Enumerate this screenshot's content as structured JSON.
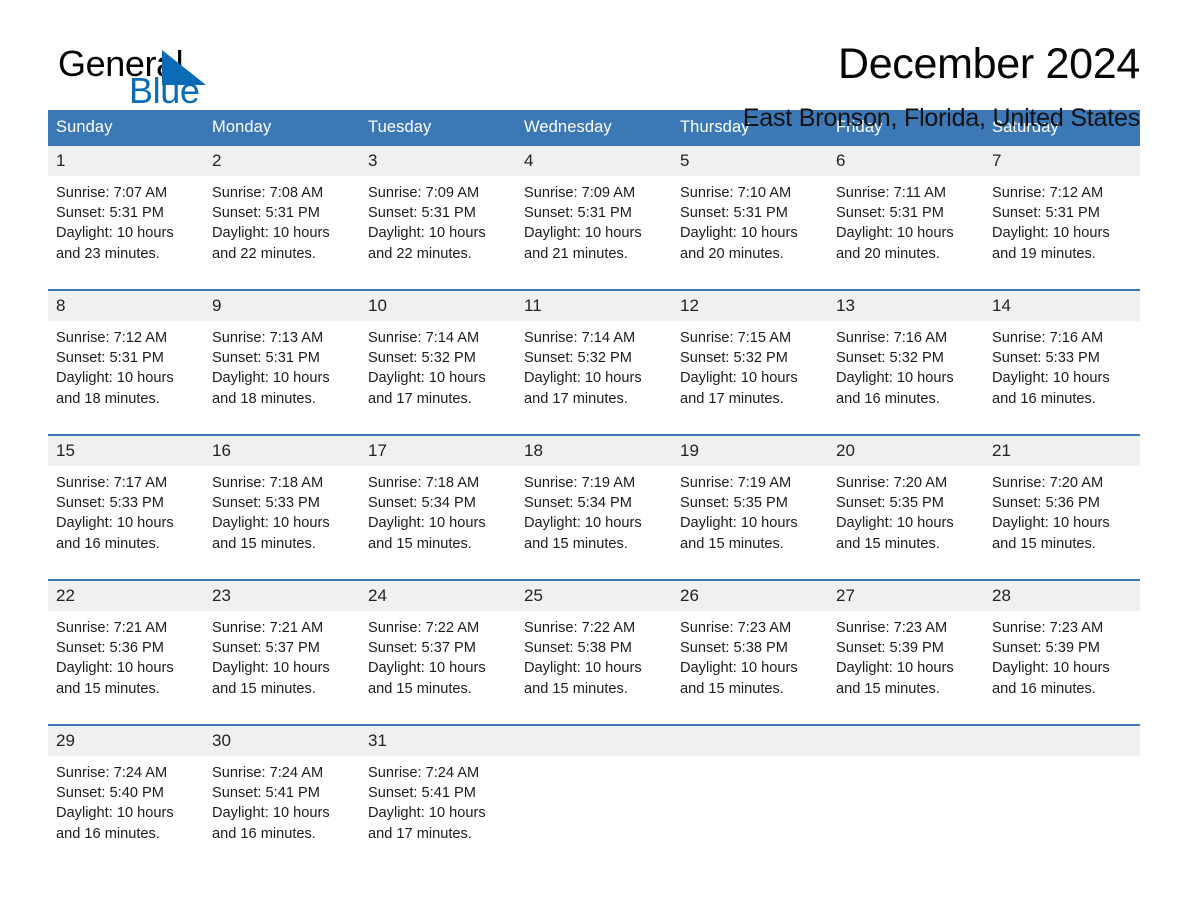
{
  "brand": {
    "word_one": "General",
    "word_two": "Blue",
    "triangle_color": "#0b6cb5",
    "text_color": "#010101"
  },
  "header": {
    "title": "December 2024",
    "subtitle": "East Bronson, Florida, United States"
  },
  "theme": {
    "header_blue": "#3b78b5",
    "daynum_bg": "#f0f0f0",
    "page_bg": "#ffffff"
  },
  "calendar": {
    "weekdays": [
      "Sunday",
      "Monday",
      "Tuesday",
      "Wednesday",
      "Thursday",
      "Friday",
      "Saturday"
    ],
    "weeks": [
      [
        {
          "day": "1",
          "sunrise": "Sunrise: 7:07 AM",
          "sunset": "Sunset: 5:31 PM",
          "daylight": "Daylight: 10 hours and 23 minutes."
        },
        {
          "day": "2",
          "sunrise": "Sunrise: 7:08 AM",
          "sunset": "Sunset: 5:31 PM",
          "daylight": "Daylight: 10 hours and 22 minutes."
        },
        {
          "day": "3",
          "sunrise": "Sunrise: 7:09 AM",
          "sunset": "Sunset: 5:31 PM",
          "daylight": "Daylight: 10 hours and 22 minutes."
        },
        {
          "day": "4",
          "sunrise": "Sunrise: 7:09 AM",
          "sunset": "Sunset: 5:31 PM",
          "daylight": "Daylight: 10 hours and 21 minutes."
        },
        {
          "day": "5",
          "sunrise": "Sunrise: 7:10 AM",
          "sunset": "Sunset: 5:31 PM",
          "daylight": "Daylight: 10 hours and 20 minutes."
        },
        {
          "day": "6",
          "sunrise": "Sunrise: 7:11 AM",
          "sunset": "Sunset: 5:31 PM",
          "daylight": "Daylight: 10 hours and 20 minutes."
        },
        {
          "day": "7",
          "sunrise": "Sunrise: 7:12 AM",
          "sunset": "Sunset: 5:31 PM",
          "daylight": "Daylight: 10 hours and 19 minutes."
        }
      ],
      [
        {
          "day": "8",
          "sunrise": "Sunrise: 7:12 AM",
          "sunset": "Sunset: 5:31 PM",
          "daylight": "Daylight: 10 hours and 18 minutes."
        },
        {
          "day": "9",
          "sunrise": "Sunrise: 7:13 AM",
          "sunset": "Sunset: 5:31 PM",
          "daylight": "Daylight: 10 hours and 18 minutes."
        },
        {
          "day": "10",
          "sunrise": "Sunrise: 7:14 AM",
          "sunset": "Sunset: 5:32 PM",
          "daylight": "Daylight: 10 hours and 17 minutes."
        },
        {
          "day": "11",
          "sunrise": "Sunrise: 7:14 AM",
          "sunset": "Sunset: 5:32 PM",
          "daylight": "Daylight: 10 hours and 17 minutes."
        },
        {
          "day": "12",
          "sunrise": "Sunrise: 7:15 AM",
          "sunset": "Sunset: 5:32 PM",
          "daylight": "Daylight: 10 hours and 17 minutes."
        },
        {
          "day": "13",
          "sunrise": "Sunrise: 7:16 AM",
          "sunset": "Sunset: 5:32 PM",
          "daylight": "Daylight: 10 hours and 16 minutes."
        },
        {
          "day": "14",
          "sunrise": "Sunrise: 7:16 AM",
          "sunset": "Sunset: 5:33 PM",
          "daylight": "Daylight: 10 hours and 16 minutes."
        }
      ],
      [
        {
          "day": "15",
          "sunrise": "Sunrise: 7:17 AM",
          "sunset": "Sunset: 5:33 PM",
          "daylight": "Daylight: 10 hours and 16 minutes."
        },
        {
          "day": "16",
          "sunrise": "Sunrise: 7:18 AM",
          "sunset": "Sunset: 5:33 PM",
          "daylight": "Daylight: 10 hours and 15 minutes."
        },
        {
          "day": "17",
          "sunrise": "Sunrise: 7:18 AM",
          "sunset": "Sunset: 5:34 PM",
          "daylight": "Daylight: 10 hours and 15 minutes."
        },
        {
          "day": "18",
          "sunrise": "Sunrise: 7:19 AM",
          "sunset": "Sunset: 5:34 PM",
          "daylight": "Daylight: 10 hours and 15 minutes."
        },
        {
          "day": "19",
          "sunrise": "Sunrise: 7:19 AM",
          "sunset": "Sunset: 5:35 PM",
          "daylight": "Daylight: 10 hours and 15 minutes."
        },
        {
          "day": "20",
          "sunrise": "Sunrise: 7:20 AM",
          "sunset": "Sunset: 5:35 PM",
          "daylight": "Daylight: 10 hours and 15 minutes."
        },
        {
          "day": "21",
          "sunrise": "Sunrise: 7:20 AM",
          "sunset": "Sunset: 5:36 PM",
          "daylight": "Daylight: 10 hours and 15 minutes."
        }
      ],
      [
        {
          "day": "22",
          "sunrise": "Sunrise: 7:21 AM",
          "sunset": "Sunset: 5:36 PM",
          "daylight": "Daylight: 10 hours and 15 minutes."
        },
        {
          "day": "23",
          "sunrise": "Sunrise: 7:21 AM",
          "sunset": "Sunset: 5:37 PM",
          "daylight": "Daylight: 10 hours and 15 minutes."
        },
        {
          "day": "24",
          "sunrise": "Sunrise: 7:22 AM",
          "sunset": "Sunset: 5:37 PM",
          "daylight": "Daylight: 10 hours and 15 minutes."
        },
        {
          "day": "25",
          "sunrise": "Sunrise: 7:22 AM",
          "sunset": "Sunset: 5:38 PM",
          "daylight": "Daylight: 10 hours and 15 minutes."
        },
        {
          "day": "26",
          "sunrise": "Sunrise: 7:23 AM",
          "sunset": "Sunset: 5:38 PM",
          "daylight": "Daylight: 10 hours and 15 minutes."
        },
        {
          "day": "27",
          "sunrise": "Sunrise: 7:23 AM",
          "sunset": "Sunset: 5:39 PM",
          "daylight": "Daylight: 10 hours and 15 minutes."
        },
        {
          "day": "28",
          "sunrise": "Sunrise: 7:23 AM",
          "sunset": "Sunset: 5:39 PM",
          "daylight": "Daylight: 10 hours and 16 minutes."
        }
      ],
      [
        {
          "day": "29",
          "sunrise": "Sunrise: 7:24 AM",
          "sunset": "Sunset: 5:40 PM",
          "daylight": "Daylight: 10 hours and 16 minutes."
        },
        {
          "day": "30",
          "sunrise": "Sunrise: 7:24 AM",
          "sunset": "Sunset: 5:41 PM",
          "daylight": "Daylight: 10 hours and 16 minutes."
        },
        {
          "day": "31",
          "sunrise": "Sunrise: 7:24 AM",
          "sunset": "Sunset: 5:41 PM",
          "daylight": "Daylight: 10 hours and 17 minutes."
        },
        {
          "day": "",
          "sunrise": "",
          "sunset": "",
          "daylight": ""
        },
        {
          "day": "",
          "sunrise": "",
          "sunset": "",
          "daylight": ""
        },
        {
          "day": "",
          "sunrise": "",
          "sunset": "",
          "daylight": ""
        },
        {
          "day": "",
          "sunrise": "",
          "sunset": "",
          "daylight": ""
        }
      ]
    ]
  }
}
